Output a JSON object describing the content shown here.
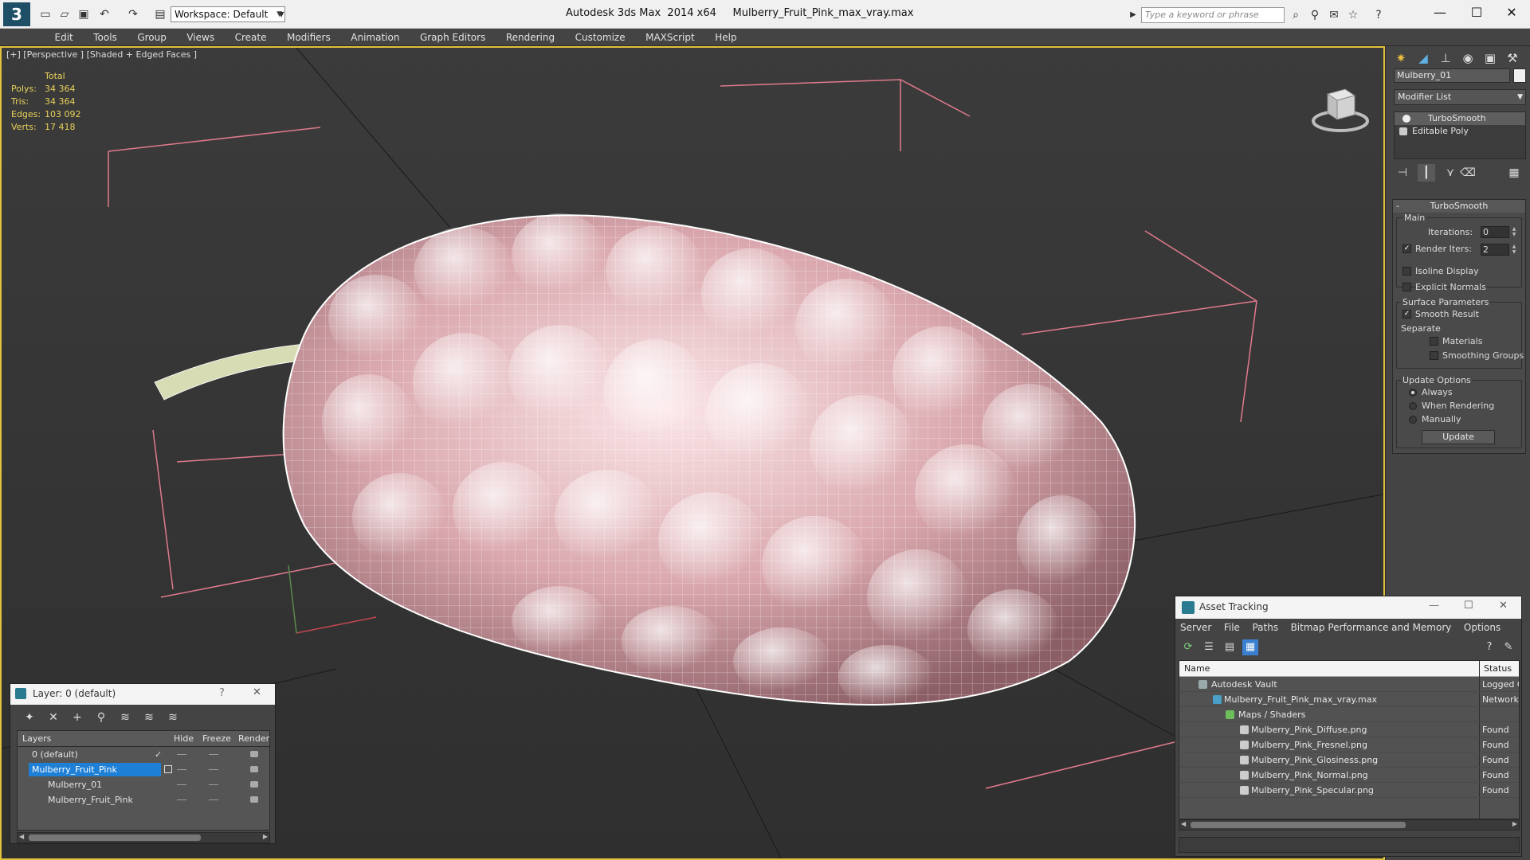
{
  "app": {
    "title": "Autodesk 3ds Max  2014 x64     Mulberry_Fruit_Pink_max_vray.max",
    "logo_glyph": "3",
    "workspace_label": "Workspace: Default",
    "search_placeholder": "Type a keyword or phrase"
  },
  "menu": [
    "Edit",
    "Tools",
    "Group",
    "Views",
    "Create",
    "Modifiers",
    "Animation",
    "Graph Editors",
    "Rendering",
    "Customize",
    "MAXScript",
    "Help"
  ],
  "viewport": {
    "label": "[+] [Perspective ] [Shaded + Edged Faces ]",
    "stats_header": "Total",
    "stats": [
      {
        "label": "Polys:",
        "value": "34 364"
      },
      {
        "label": "Tris:",
        "value": "34 364"
      },
      {
        "label": "Edges:",
        "value": "103 092"
      },
      {
        "label": "Verts:",
        "value": "17 418"
      }
    ],
    "stats_color": "#e8d25a",
    "border_color": "#e0c23c"
  },
  "command_panel": {
    "object_name": "Mulberry_01",
    "modifier_list": "Modifier List",
    "stack": [
      "TurboSmooth",
      "Editable Poly"
    ],
    "rollout_title": "TurboSmooth",
    "main_label": "Main",
    "iterations_label": "Iterations:",
    "iterations_value": "0",
    "render_iters_label": "Render Iters:",
    "render_iters_value": "2",
    "isoline_label": "Isoline Display",
    "explicit_normals_label": "Explicit Normals",
    "surface_params_label": "Surface Parameters",
    "smooth_result_label": "Smooth Result",
    "separate_label": "Separate",
    "materials_label": "Materials",
    "smoothing_groups_label": "Smoothing Groups",
    "update_options_label": "Update Options",
    "always_label": "Always",
    "when_rendering_label": "When Rendering",
    "manually_label": "Manually",
    "update_button": "Update"
  },
  "layer_window": {
    "title": "Layer: 0 (default)",
    "help": "?",
    "close": "✕",
    "columns": [
      "Layers",
      "Hide",
      "Freeze",
      "Render"
    ],
    "rows": [
      {
        "name": "0 (default)",
        "indent": 0
      },
      {
        "name": "Mulberry_Fruit_Pink",
        "indent": 0
      },
      {
        "name": "Mulberry_01",
        "indent": 1
      },
      {
        "name": "Mulberry_Fruit_Pink",
        "indent": 1
      }
    ]
  },
  "asset_window": {
    "title": "Asset Tracking",
    "menu": [
      "Server",
      "File",
      "Paths",
      "Bitmap Performance and Memory",
      "Options"
    ],
    "columns": [
      "Name",
      "Status"
    ],
    "rows": [
      {
        "name": "Autodesk Vault",
        "status": "Logged C",
        "level": 0
      },
      {
        "name": "Mulberry_Fruit_Pink_max_vray.max",
        "status": "Network I",
        "level": 1
      },
      {
        "name": "Maps / Shaders",
        "status": "",
        "level": 2
      },
      {
        "name": "Mulberry_Pink_Diffuse.png",
        "status": "Found",
        "level": 3
      },
      {
        "name": "Mulberry_Pink_Fresnel.png",
        "status": "Found",
        "level": 3
      },
      {
        "name": "Mulberry_Pink_Glosiness.png",
        "status": "Found",
        "level": 3
      },
      {
        "name": "Mulberry_Pink_Normal.png",
        "status": "Found",
        "level": 3
      },
      {
        "name": "Mulberry_Pink_Specular.png",
        "status": "Found",
        "level": 3
      }
    ]
  },
  "icons": {
    "new": "new-file-icon",
    "open": "open-file-icon",
    "save": "save-icon",
    "undo": "undo-icon",
    "redo": "redo-icon"
  }
}
